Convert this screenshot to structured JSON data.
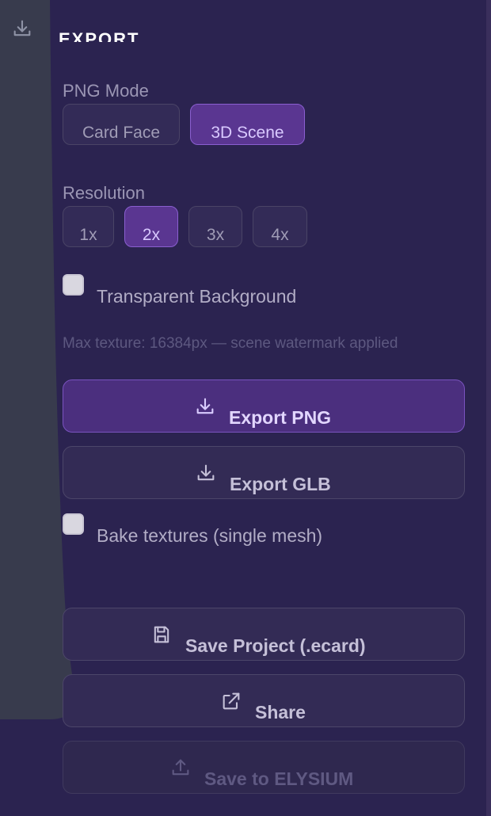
{
  "panel": {
    "title": "EXPORT"
  },
  "png_mode": {
    "label": "PNG Mode",
    "options": [
      "Card Face",
      "3D Scene"
    ],
    "selected": "3D Scene"
  },
  "resolution": {
    "label": "Resolution",
    "options": [
      "1x",
      "2x",
      "3x",
      "4x"
    ],
    "selected": "2x"
  },
  "transparent_background": {
    "label": "Transparent Background",
    "checked": false
  },
  "hint": "Max texture: 16384px — scene watermark applied",
  "buttons": {
    "export_png": {
      "label": "Export PNG",
      "icon": "download-icon"
    },
    "export_glb": {
      "label": "Export GLB",
      "icon": "download-icon"
    },
    "save_project": {
      "label": "Save Project (.ecard)",
      "icon": "save-icon"
    },
    "share": {
      "label": "Share",
      "icon": "external-link-icon"
    },
    "save_elysium": {
      "label": "Save to ELYSIUM",
      "icon": "upload-icon",
      "disabled": true
    }
  },
  "bake_textures": {
    "label": "Bake textures (single mesh)",
    "checked": false
  },
  "colors": {
    "background": "#2b2350",
    "accent": "#5a3691",
    "accent_border": "#8a5fd0"
  }
}
